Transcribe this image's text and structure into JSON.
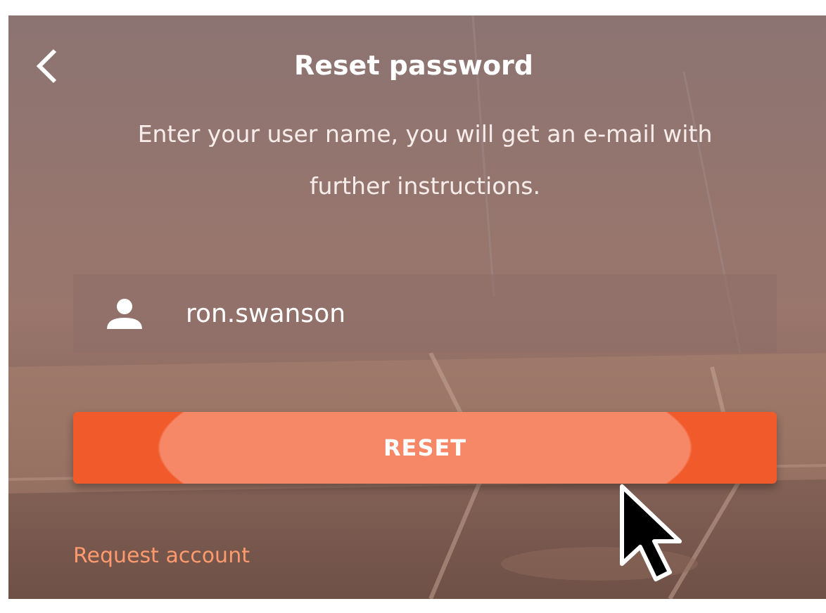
{
  "header": {
    "title": "Reset password"
  },
  "description": "Enter your user name, you will get an e-mail with further instructions.",
  "username_field": {
    "value": "ron.swanson"
  },
  "reset_button": {
    "label": "RESET"
  },
  "request_link": {
    "label": "Request account"
  }
}
